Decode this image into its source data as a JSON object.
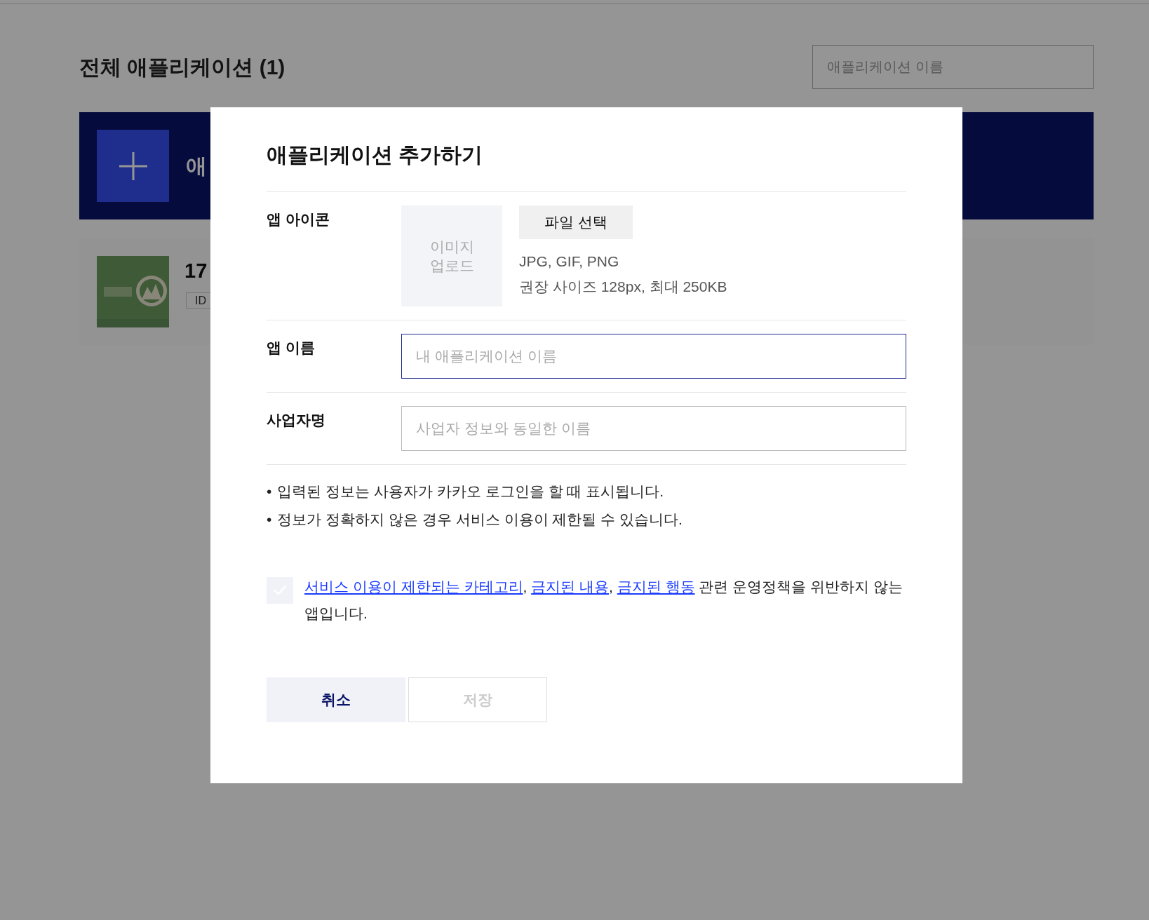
{
  "page": {
    "title": "전체 애플리케이션 (1)",
    "search": {
      "placeholder": "애플리케이션 이름"
    },
    "add_banner": {
      "label": "애"
    },
    "apps": [
      {
        "name": "17",
        "id_label": "ID"
      }
    ]
  },
  "dialog": {
    "title": "애플리케이션 추가하기",
    "icon_field": {
      "label": "앱 아이콘",
      "upload_hint": "이미지 업로드",
      "file_button": "파일 선택",
      "formats": "JPG, GIF, PNG",
      "size_note": "권장 사이즈 128px, 최대 250KB"
    },
    "name_field": {
      "label": "앱 이름",
      "placeholder": "내 애플리케이션 이름",
      "focused": true
    },
    "business_field": {
      "label": "사업자명",
      "placeholder": "사업자 정보와 동일한 이름",
      "focused": false
    },
    "notes": [
      {
        "bullet": "•",
        "text": "입력된 정보는 사용자가 카카오 로그인을 할 때 표시됩니다."
      },
      {
        "bullet": "•",
        "text": "정보가 정확하지 않은 경우 서비스 이용이 제한될 수 있습니다."
      }
    ],
    "agreement": {
      "checked": false,
      "parts": [
        {
          "kind": "link",
          "text": "서비스 이용이 제한되는 카테고리"
        },
        {
          "kind": "text",
          "text": ", "
        },
        {
          "kind": "link",
          "text": "금지된 내용"
        },
        {
          "kind": "text",
          "text": ", "
        },
        {
          "kind": "link",
          "text": "금지된 행동"
        },
        {
          "kind": "text",
          "text": " 관련 운영정책을 위반하지 않는 앱입니다."
        }
      ]
    },
    "buttons": [
      {
        "kind": "cancel",
        "label": "취소",
        "disabled": false
      },
      {
        "kind": "save",
        "label": "저장",
        "disabled": true
      }
    ]
  }
}
